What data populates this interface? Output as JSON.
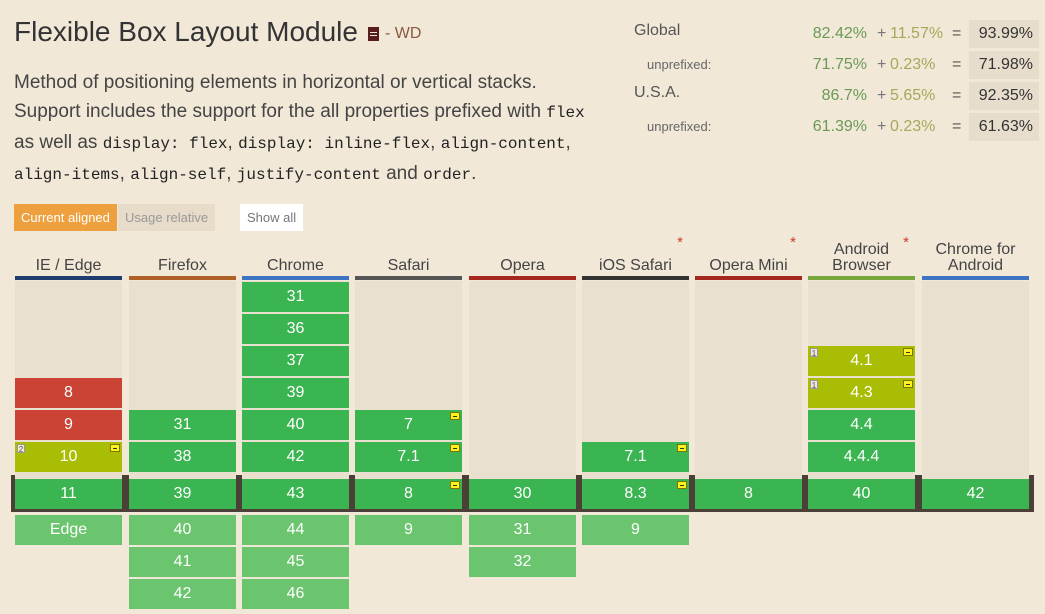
{
  "header": {
    "title": "Flexible Box Layout Module",
    "status": "- WD",
    "description_parts": [
      {
        "t": "text",
        "v": "Method of positioning elements in horizontal or vertical stacks. Support includes the support for the all properties prefixed with "
      },
      {
        "t": "code",
        "v": "flex"
      },
      {
        "t": "text",
        "v": " as well as "
      },
      {
        "t": "code",
        "v": "display: flex"
      },
      {
        "t": "text",
        "v": ", "
      },
      {
        "t": "code",
        "v": "display: inline-flex"
      },
      {
        "t": "text",
        "v": ", "
      },
      {
        "t": "code",
        "v": "align-content"
      },
      {
        "t": "text",
        "v": ", "
      },
      {
        "t": "code",
        "v": "align-items"
      },
      {
        "t": "text",
        "v": ", "
      },
      {
        "t": "code",
        "v": "align-self"
      },
      {
        "t": "text",
        "v": ", "
      },
      {
        "t": "code",
        "v": "justify-content"
      },
      {
        "t": "text",
        "v": " and "
      },
      {
        "t": "code",
        "v": "order"
      },
      {
        "t": "text",
        "v": "."
      }
    ]
  },
  "stats": [
    {
      "label": "Global",
      "sub": false,
      "a": "82.42%",
      "plus": "+",
      "b": "11.57%",
      "eq": "=",
      "total": "93.99%"
    },
    {
      "label": "unprefixed:",
      "sub": true,
      "a": "71.75%",
      "plus": "+",
      "b": "0.23%",
      "eq": "=",
      "total": "71.98%"
    },
    {
      "label": "U.S.A.",
      "sub": false,
      "a": "86.7%",
      "plus": "+",
      "b": "5.65%",
      "eq": "=",
      "total": "92.35%"
    },
    {
      "label": "unprefixed:",
      "sub": true,
      "a": "61.39%",
      "plus": "+",
      "b": "0.23%",
      "eq": "=",
      "total": "61.63%"
    }
  ],
  "buttons": {
    "current_aligned": "Current aligned",
    "usage_relative": "Usage relative",
    "show_all": "Show all"
  },
  "colors": {
    "supported": "#3bb552",
    "future_supported": "#6bc46e",
    "not_supported": "#ca4335",
    "partial": "#a8bd04",
    "accent": "#eea03e"
  },
  "browsers": [
    {
      "name": [
        "IE / Edge"
      ],
      "star": "",
      "line": "#1e3c6e",
      "cells": [
        {
          "v": "8",
          "s": "n",
          "row": 3
        },
        {
          "v": "9",
          "s": "n",
          "row": 4
        },
        {
          "v": "10",
          "s": "p",
          "row": 5,
          "mark": true,
          "note": "2"
        },
        {
          "v": "11",
          "s": "y",
          "row": "cur"
        },
        {
          "v": "Edge",
          "s": "fy",
          "row": 7
        }
      ]
    },
    {
      "name": [
        "Firefox"
      ],
      "star": "",
      "line": "#b0612a",
      "cells": [
        {
          "v": "31",
          "s": "y",
          "row": 4
        },
        {
          "v": "38",
          "s": "y",
          "row": 5
        },
        {
          "v": "39",
          "s": "y",
          "row": "cur"
        },
        {
          "v": "40",
          "s": "fy",
          "row": 7
        },
        {
          "v": "41",
          "s": "fy",
          "row": 8
        },
        {
          "v": "42",
          "s": "fy",
          "row": 9
        }
      ]
    },
    {
      "name": [
        "Chrome"
      ],
      "star": "",
      "line": "#3e74c4",
      "cells": [
        {
          "v": "31",
          "s": "y",
          "row": 0
        },
        {
          "v": "36",
          "s": "y",
          "row": 1
        },
        {
          "v": "37",
          "s": "y",
          "row": 2
        },
        {
          "v": "39",
          "s": "y",
          "row": 3
        },
        {
          "v": "40",
          "s": "y",
          "row": 4
        },
        {
          "v": "42",
          "s": "y",
          "row": 5
        },
        {
          "v": "43",
          "s": "y",
          "row": "cur"
        },
        {
          "v": "44",
          "s": "fy",
          "row": 7
        },
        {
          "v": "45",
          "s": "fy",
          "row": 8
        },
        {
          "v": "46",
          "s": "fy",
          "row": 9
        }
      ]
    },
    {
      "name": [
        "Safari"
      ],
      "star": "",
      "line": "#555555",
      "cells": [
        {
          "v": "7",
          "s": "y",
          "row": 4,
          "mark": true
        },
        {
          "v": "7.1",
          "s": "y",
          "row": 5,
          "mark": true
        },
        {
          "v": "8",
          "s": "y",
          "row": "cur",
          "mark": true
        },
        {
          "v": "9",
          "s": "fy",
          "row": 7
        }
      ]
    },
    {
      "name": [
        "Opera"
      ],
      "star": "",
      "line": "#a5281f",
      "cells": [
        {
          "v": "30",
          "s": "y",
          "row": "cur"
        },
        {
          "v": "31",
          "s": "fy",
          "row": 7
        },
        {
          "v": "32",
          "s": "fy",
          "row": 8
        }
      ]
    },
    {
      "name": [
        "iOS Safari"
      ],
      "star": "*",
      "line": "#333333",
      "cells": [
        {
          "v": "7.1",
          "s": "y",
          "row": 5,
          "mark": true
        },
        {
          "v": "8.3",
          "s": "y",
          "row": "cur",
          "mark": true
        },
        {
          "v": "9",
          "s": "fy",
          "row": 7
        }
      ]
    },
    {
      "name": [
        "Opera Mini"
      ],
      "star": "*",
      "line": "#a5281f",
      "cells": [
        {
          "v": "8",
          "s": "y",
          "row": "cur"
        }
      ]
    },
    {
      "name": [
        "Android",
        "Browser"
      ],
      "star": "*",
      "line": "#76a63c",
      "cells": [
        {
          "v": "4.1",
          "s": "p",
          "row": 2,
          "mark": true,
          "note": "1"
        },
        {
          "v": "4.3",
          "s": "p",
          "row": 3,
          "mark": true,
          "note": "1"
        },
        {
          "v": "4.4",
          "s": "y",
          "row": 4
        },
        {
          "v": "4.4.4",
          "s": "y",
          "row": 5
        },
        {
          "v": "40",
          "s": "y",
          "row": "cur"
        }
      ]
    },
    {
      "name": [
        "Chrome for",
        "Android"
      ],
      "star": "",
      "line": "#3e74c4",
      "cells": [
        {
          "v": "42",
          "s": "y",
          "row": "cur"
        }
      ]
    }
  ]
}
